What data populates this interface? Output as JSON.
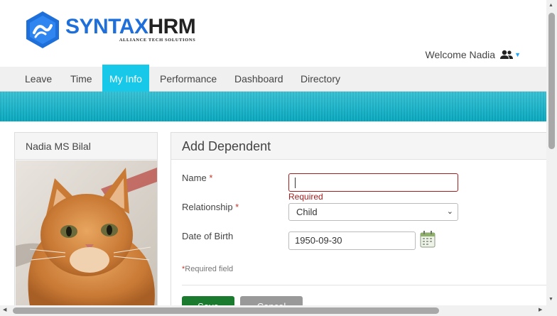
{
  "header": {
    "brand_primary": "SYNTAX",
    "brand_secondary": "HRM",
    "brand_tagline": "ALLIANCE TECH SOLUTIONS",
    "welcome_text": "Welcome Nadia"
  },
  "nav": {
    "items": [
      {
        "label": "Leave"
      },
      {
        "label": "Time"
      },
      {
        "label": "My Info",
        "active": true
      },
      {
        "label": "Performance"
      },
      {
        "label": "Dashboard"
      },
      {
        "label": "Directory"
      }
    ]
  },
  "profile": {
    "name": "Nadia MS Bilal"
  },
  "form": {
    "title": "Add Dependent",
    "name_label": "Name",
    "required_mark": "*",
    "name_value": "",
    "name_error": "Required",
    "relationship_label": "Relationship",
    "relationship_value": "Child",
    "dob_label": "Date of Birth",
    "dob_value": "1950-09-30",
    "required_note": "Required field",
    "save_label": "Save",
    "cancel_label": "Cancel"
  },
  "colors": {
    "accent": "#18c8e8",
    "brand_blue": "#1e6fd9",
    "save_green": "#1a7a2e",
    "error": "#a02020"
  }
}
